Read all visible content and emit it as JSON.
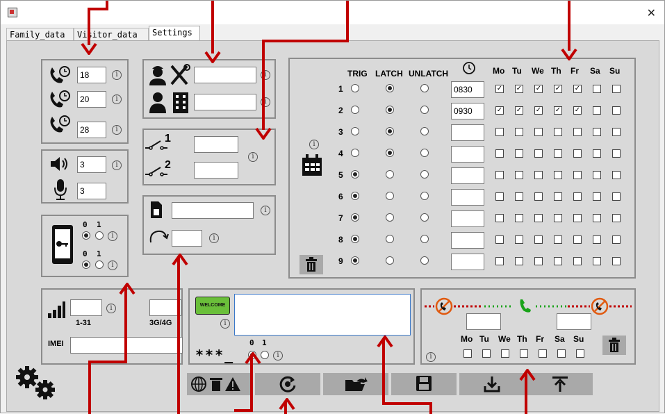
{
  "window": {
    "close_glyph": "✕"
  },
  "tabs": [
    "Family_data",
    "Visitor_data",
    "Settings"
  ],
  "call": {
    "values": [
      "18",
      "20",
      "28"
    ]
  },
  "volume": {
    "speaker": "3",
    "mic": "3"
  },
  "app": {
    "radio_labels": [
      "0",
      "1"
    ]
  },
  "installer": {
    "values": [
      "",
      ""
    ]
  },
  "relay": {
    "labels": [
      "1",
      "2"
    ]
  },
  "sim": {
    "values": [
      "",
      ""
    ]
  },
  "schedule": {
    "headers": {
      "trig": "TRIG",
      "latch": "LATCH",
      "unlatch": "UNLATCH"
    },
    "days": [
      "Mo",
      "Tu",
      "We",
      "Th",
      "Fr",
      "Sa",
      "Su"
    ],
    "rows": [
      {
        "n": "1",
        "mode": 1,
        "time": "0830",
        "days": [
          1,
          1,
          1,
          1,
          1,
          0,
          0
        ]
      },
      {
        "n": "2",
        "mode": 1,
        "time": "0930",
        "days": [
          1,
          1,
          1,
          1,
          1,
          0,
          0
        ]
      },
      {
        "n": "3",
        "mode": 1,
        "time": "",
        "days": [
          0,
          0,
          0,
          0,
          0,
          0,
          0
        ]
      },
      {
        "n": "4",
        "mode": 1,
        "time": "",
        "days": [
          0,
          0,
          0,
          0,
          0,
          0,
          0
        ]
      },
      {
        "n": "5",
        "mode": 0,
        "time": "",
        "days": [
          0,
          0,
          0,
          0,
          0,
          0,
          0
        ]
      },
      {
        "n": "6",
        "mode": 0,
        "time": "",
        "days": [
          0,
          0,
          0,
          0,
          0,
          0,
          0
        ]
      },
      {
        "n": "7",
        "mode": 0,
        "time": "",
        "days": [
          0,
          0,
          0,
          0,
          0,
          0,
          0
        ]
      },
      {
        "n": "8",
        "mode": 0,
        "time": "",
        "days": [
          0,
          0,
          0,
          0,
          0,
          0,
          0
        ]
      },
      {
        "n": "9",
        "mode": 0,
        "time": "",
        "days": [
          0,
          0,
          0,
          0,
          0,
          0,
          0
        ]
      }
    ]
  },
  "signal": {
    "range_label": "1-31",
    "network_label": "3G/4G",
    "imei_label": "IMEI"
  },
  "welcome": {
    "badge": "WELCOME",
    "stars": "***_",
    "radio_labels": [
      "0",
      "1"
    ]
  },
  "dnd": {
    "days": [
      "Mo",
      "Tu",
      "We",
      "Th",
      "Fr",
      "Sa",
      "Su"
    ]
  },
  "colors": {
    "accent_red": "#c00000",
    "welcome_green": "#6abf3a",
    "call_green": "#19a319",
    "dnd_orange": "#e05a10"
  }
}
